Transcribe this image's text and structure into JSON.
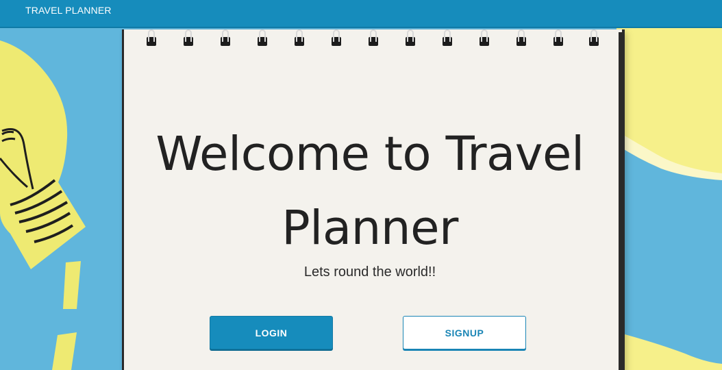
{
  "navbar": {
    "brand": "TRAVEL PLANNER"
  },
  "hero": {
    "title": "Welcome to Travel Planner",
    "subtitle": "Lets round the world!!",
    "login_label": "LOGIN",
    "signup_label": "SIGNUP"
  },
  "colors": {
    "navbar": "#168cbc",
    "accent": "#168cbc",
    "background_blue": "#60b6dc",
    "paper_yellow": "#f4ee7a",
    "notepad": "#f4f2ed"
  },
  "icons": [
    "lightbulb-drawing-icon",
    "spiral-binding-icon"
  ]
}
